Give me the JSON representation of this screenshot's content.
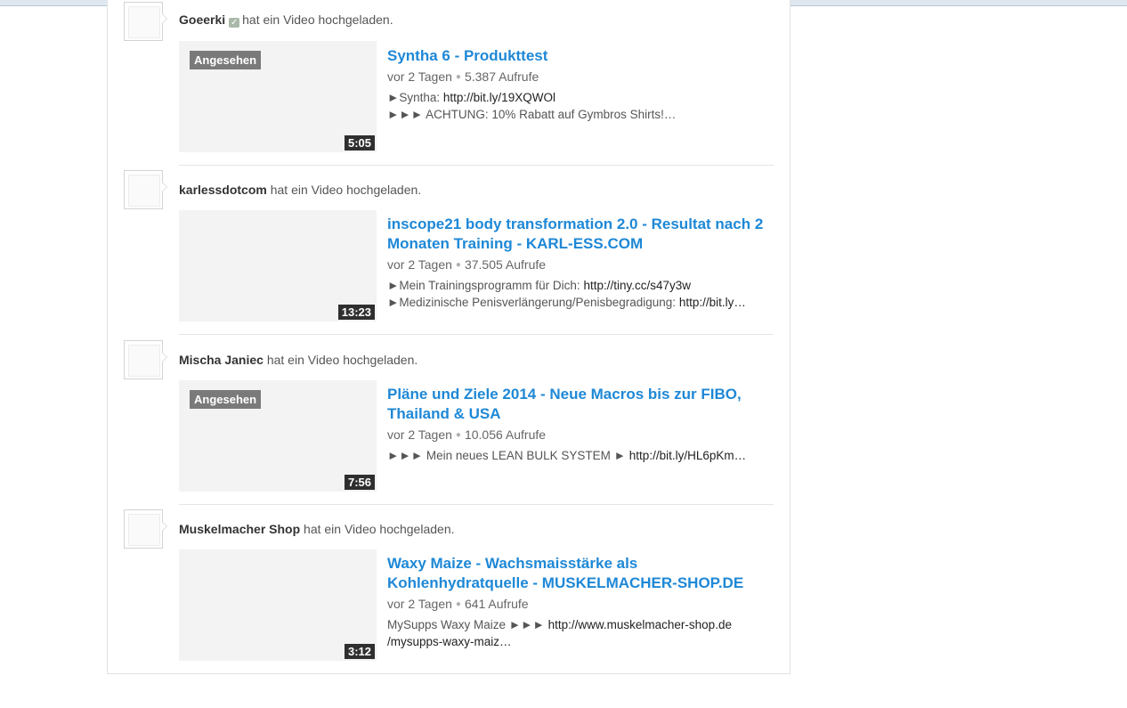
{
  "feed": {
    "action_text": "hat ein Video hochgeladen.",
    "items": [
      {
        "channel": "Goeerki",
        "verified": true,
        "watched_label": "Angesehen",
        "duration": "5:05",
        "title_line1": "Syntha 6 - Produkttest",
        "title_line2": "",
        "age": "vor 2 Tagen",
        "views": "5.387 Aufrufe",
        "desc1_text": "►Syntha: ",
        "desc1_link": "http://bit.ly/19XQWOl",
        "desc2_text": "►►► ACHTUNG: 10% Rabatt auf Gymbros Shirts!…",
        "desc2_link": ""
      },
      {
        "channel": "karlessdotcom",
        "verified": false,
        "watched_label": "",
        "duration": "13:23",
        "title_line1": "inscope21 body transformation 2.0 - Resultat nach 2",
        "title_line2": "Monaten Training - KARL-ESS.COM",
        "age": "vor 2 Tagen",
        "views": "37.505 Aufrufe",
        "desc1_text": "►Mein Trainingsprogramm für Dich: ",
        "desc1_link": "http://tiny.cc/s47y3w",
        "desc2_text": "►Medizinische Penisverlängerung/Penisbegradigung: ",
        "desc2_link": "http://bit.ly…"
      },
      {
        "channel": "Mischa Janiec",
        "verified": false,
        "watched_label": "Angesehen",
        "duration": "7:56",
        "title_line1": "Pläne und Ziele 2014 - Neue Macros bis zur FIBO,",
        "title_line2": "Thailand & USA",
        "age": "vor 2 Tagen",
        "views": "10.056 Aufrufe",
        "desc1_text": "►►► Mein neues LEAN BULK SYSTEM ► ",
        "desc1_link": "http://bit.ly/HL6pKm…",
        "desc2_text": "",
        "desc2_link": ""
      },
      {
        "channel": "Muskelmacher Shop",
        "verified": false,
        "watched_label": "",
        "duration": "3:12",
        "title_line1": "Waxy Maize - Wachsmaisstärke als",
        "title_line2": "Kohlenhydratquelle - MUSKELMACHER-SHOP.DE",
        "age": "vor 2 Tagen",
        "views": "641 Aufrufe",
        "desc1_text": "MySupps Waxy Maize ►►► ",
        "desc1_link": "http://www.muskelmacher-shop.de",
        "desc2_text": "",
        "desc2_link": "/mysupps-waxy-maiz…"
      }
    ]
  }
}
